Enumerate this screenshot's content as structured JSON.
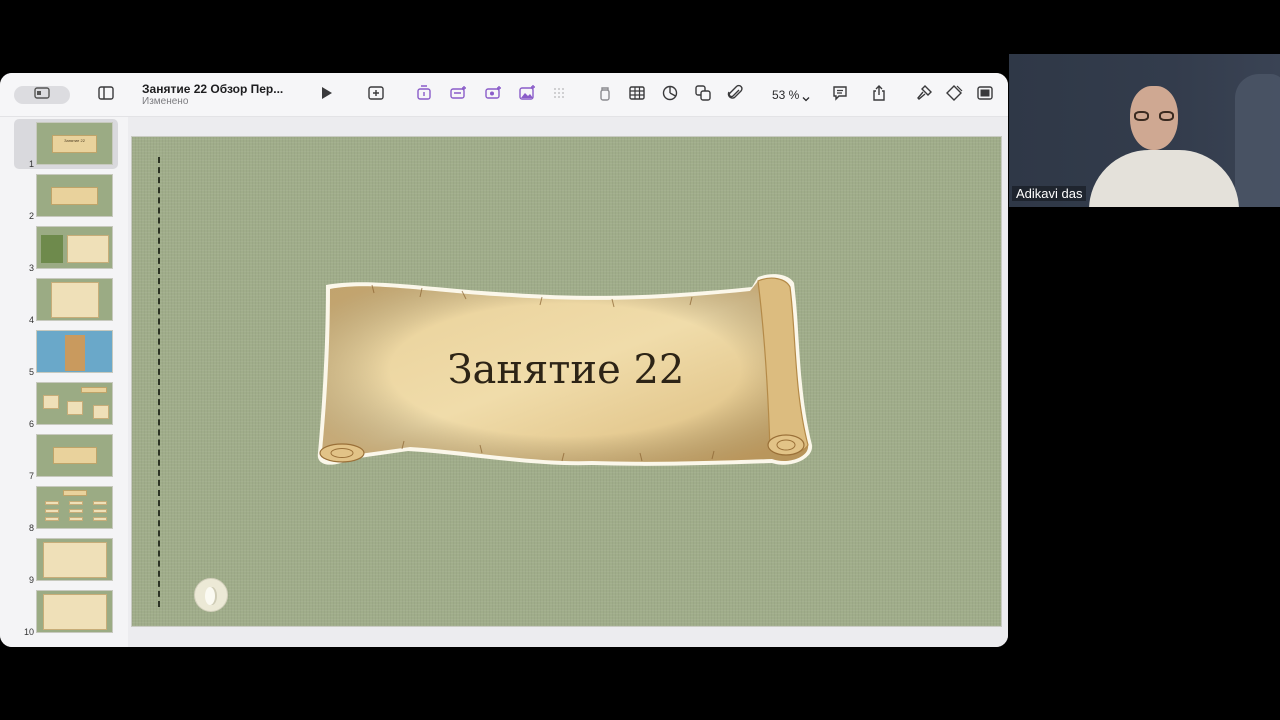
{
  "window": {
    "doc_title": "Занятие 22 Обзор Пер...",
    "doc_status": "Изменено",
    "zoom_label": "53 %"
  },
  "toolbar": {
    "icons": [
      "view-icon",
      "sidebar-icon",
      "play-icon",
      "add-slide-icon",
      "insert-shape-icon",
      "insert-text-icon",
      "insert-media-icon",
      "insert-image-icon",
      "grid-icon",
      "share-lock-icon",
      "table-icon",
      "chart-icon",
      "shapes-icon",
      "attachment-icon",
      "comment-icon",
      "share-icon",
      "format-icon",
      "animate-icon",
      "document-icon"
    ]
  },
  "navigator": {
    "slides": [
      {
        "num": "1",
        "label": "Занятие 22"
      },
      {
        "num": "2",
        "label": ""
      },
      {
        "num": "3",
        "label": ""
      },
      {
        "num": "4",
        "label": ""
      },
      {
        "num": "5",
        "label": ""
      },
      {
        "num": "6",
        "label": ""
      },
      {
        "num": "7",
        "label": ""
      },
      {
        "num": "8",
        "label": ""
      },
      {
        "num": "9",
        "label": ""
      },
      {
        "num": "10",
        "label": ""
      }
    ],
    "active_index": 0
  },
  "slide": {
    "title": "Занятие 22",
    "background_color": "#a0ad8a",
    "scroll_color": "#e4c98f"
  },
  "video": {
    "participant_name": "Adikavi das"
  }
}
